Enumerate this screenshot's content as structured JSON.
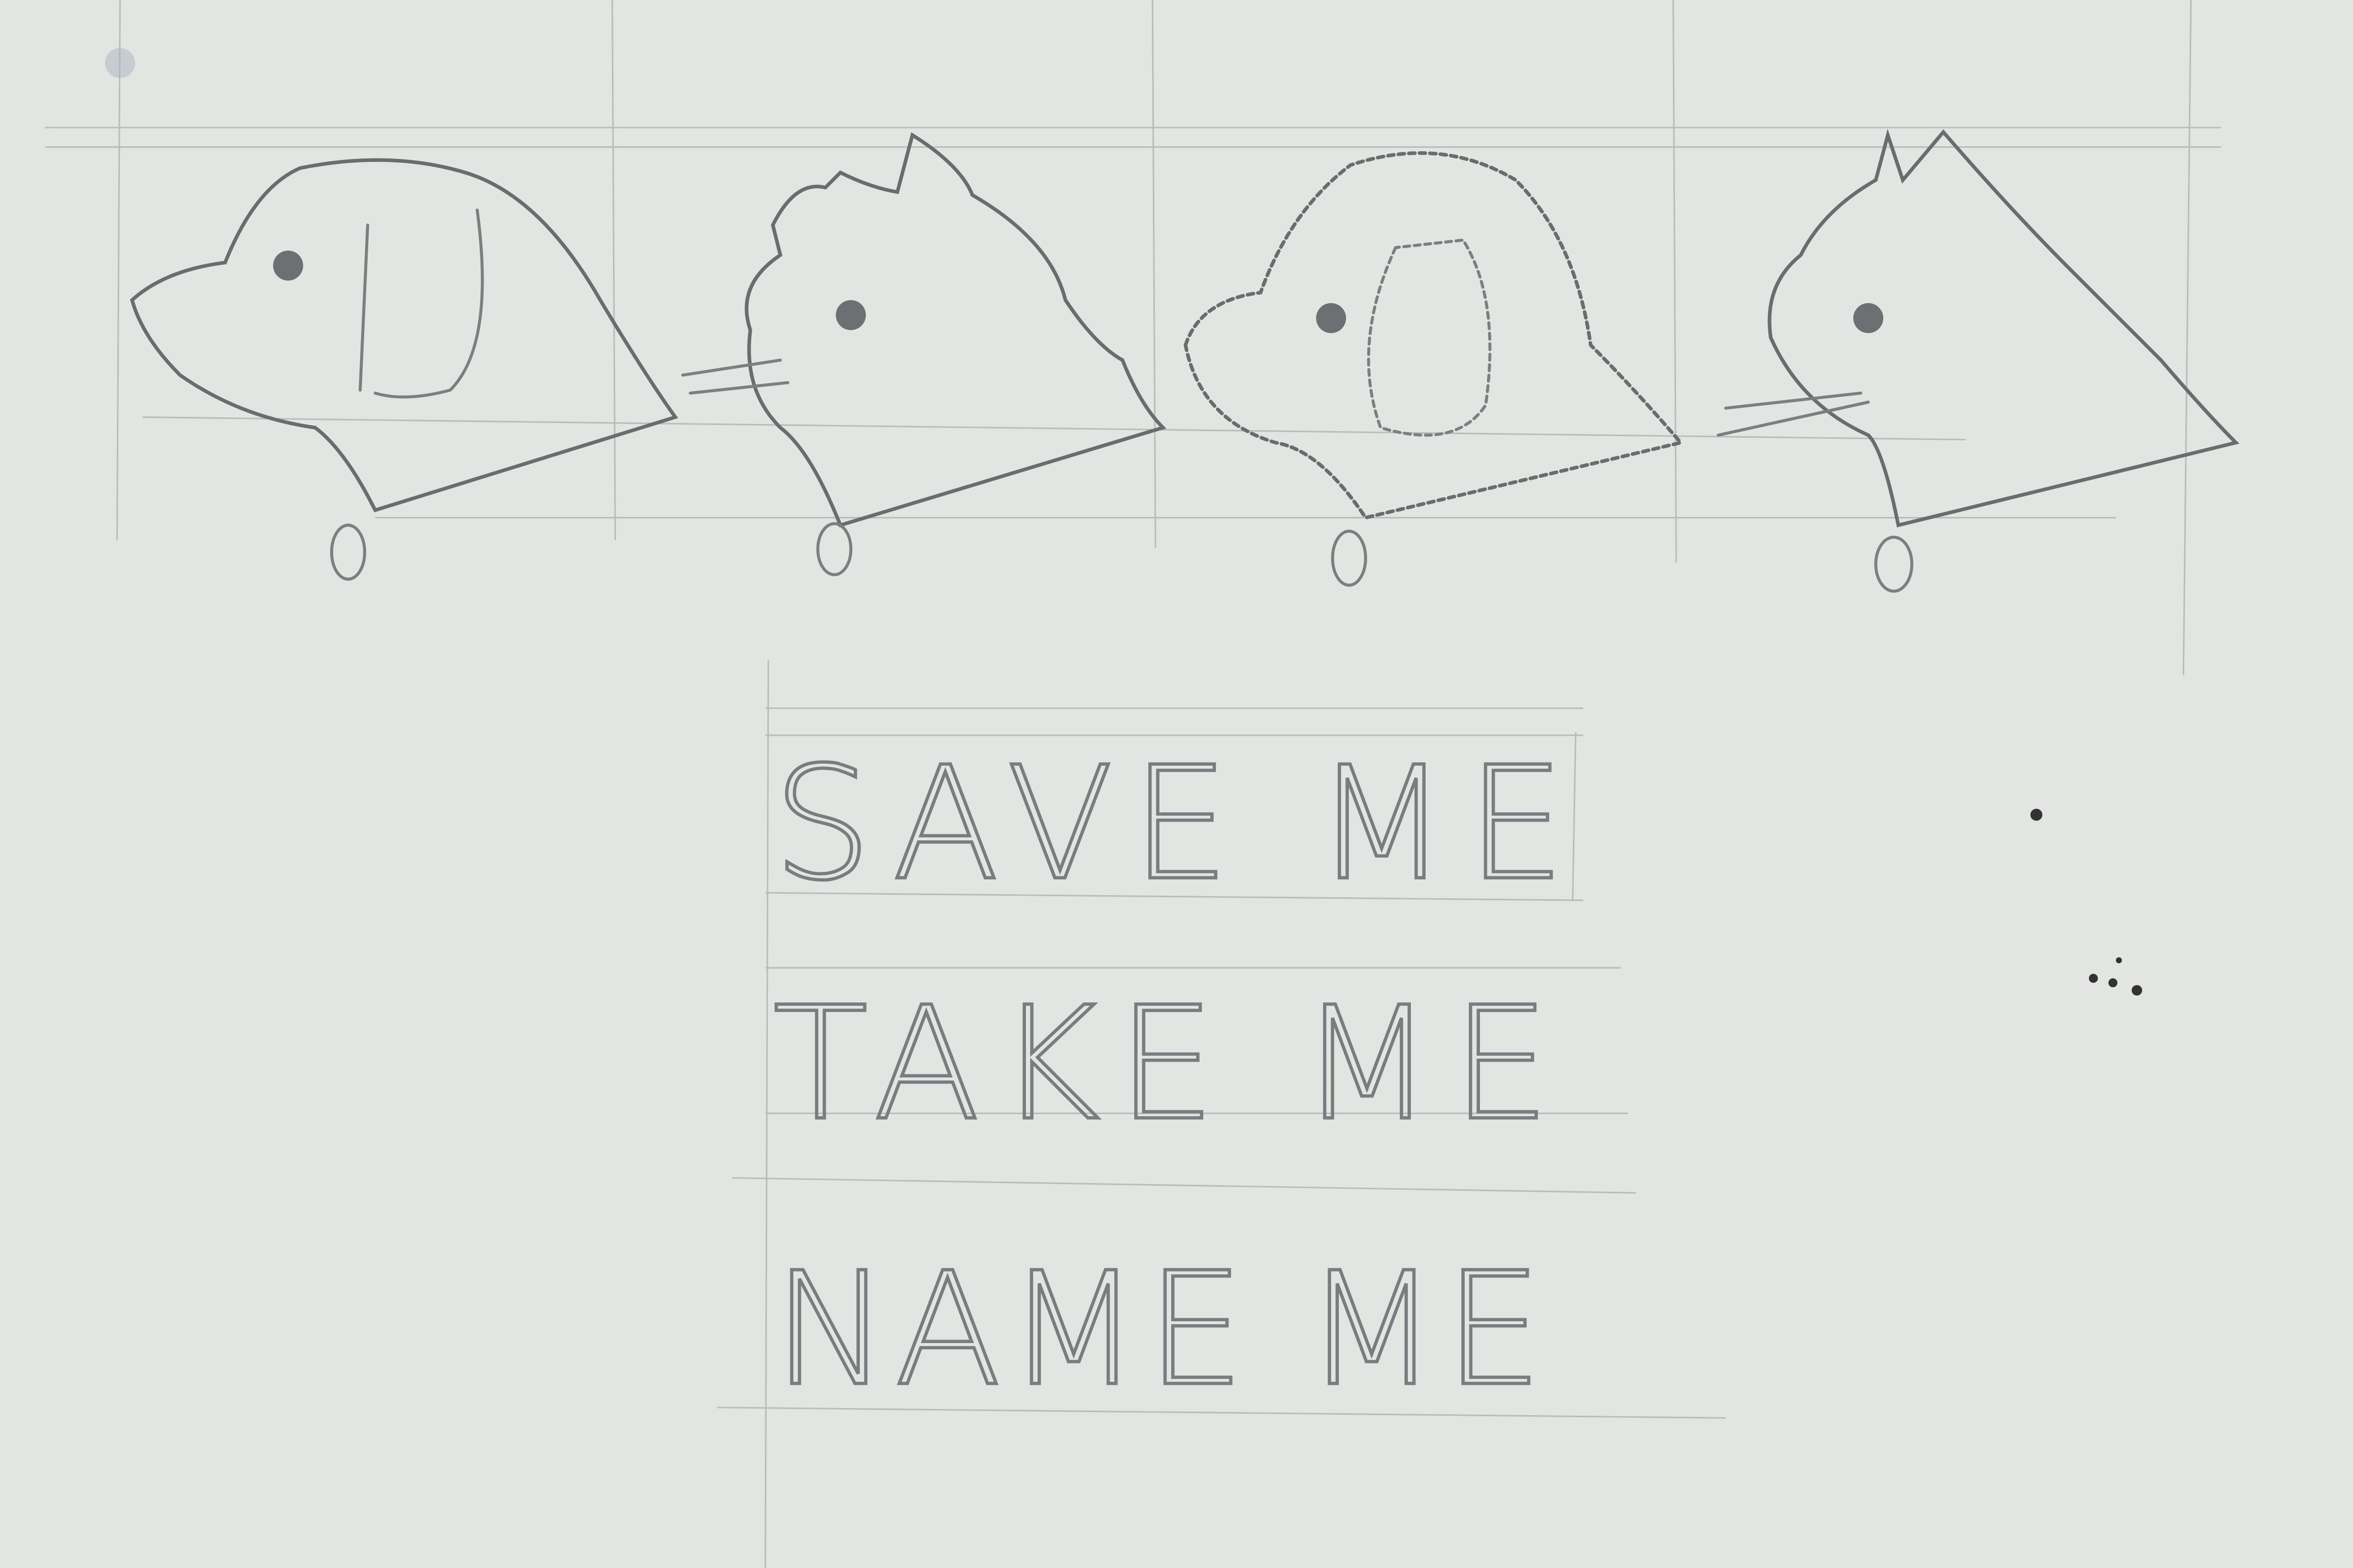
{
  "colors": {
    "paper": "#e3e5e2",
    "pencil": "#7c7f80",
    "guide": "#b9bcbb"
  },
  "sketch": {
    "animals": [
      {
        "kind": "dog-smooth"
      },
      {
        "kind": "cat-fluffy"
      },
      {
        "kind": "dog-curly"
      },
      {
        "kind": "cat-smooth"
      }
    ],
    "slogan_lines": [
      "SAVE ME",
      "TAKE ME",
      "NAME ME"
    ]
  }
}
